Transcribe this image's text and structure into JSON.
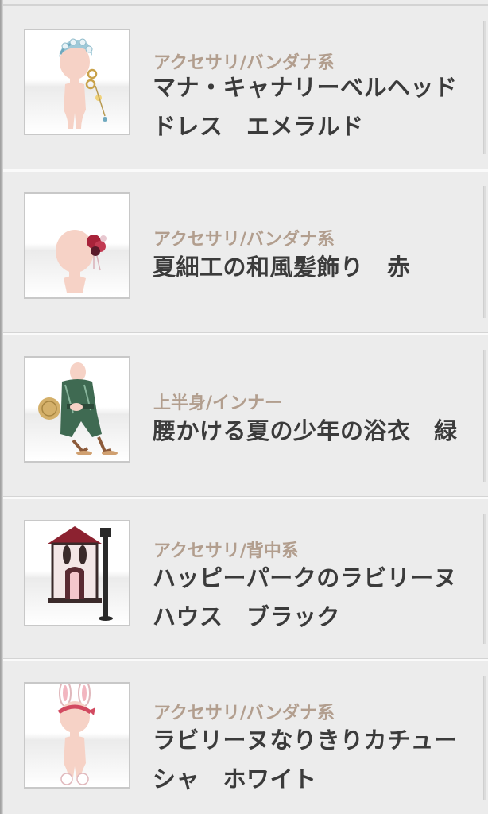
{
  "items": [
    {
      "category": "アクセサリ/バンダナ系",
      "name": "マナ・キャナリーベルヘッドドレス　エメラルド",
      "thumb_icon": "headdress-doll-icon"
    },
    {
      "category": "アクセサリ/バンダナ系",
      "name": "夏細工の和風髪飾り　赤",
      "thumb_icon": "hair-ornament-doll-icon"
    },
    {
      "category": "上半身/インナー",
      "name": "腰かける夏の少年の浴衣　緑",
      "thumb_icon": "yukata-doll-icon"
    },
    {
      "category": "アクセサリ/背中系",
      "name": "ハッピーパークのラビリーヌハウス　ブラック",
      "thumb_icon": "rabbit-house-icon"
    },
    {
      "category": "アクセサリ/バンダナ系",
      "name": "ラビリーヌなりきりカチューシャ　ホワイト",
      "thumb_icon": "bunny-headband-doll-icon"
    }
  ],
  "colors": {
    "background": "#ececec",
    "category_text": "#b29e8e",
    "name_text": "#3b3b3b",
    "divider": "#d4d4d4"
  }
}
